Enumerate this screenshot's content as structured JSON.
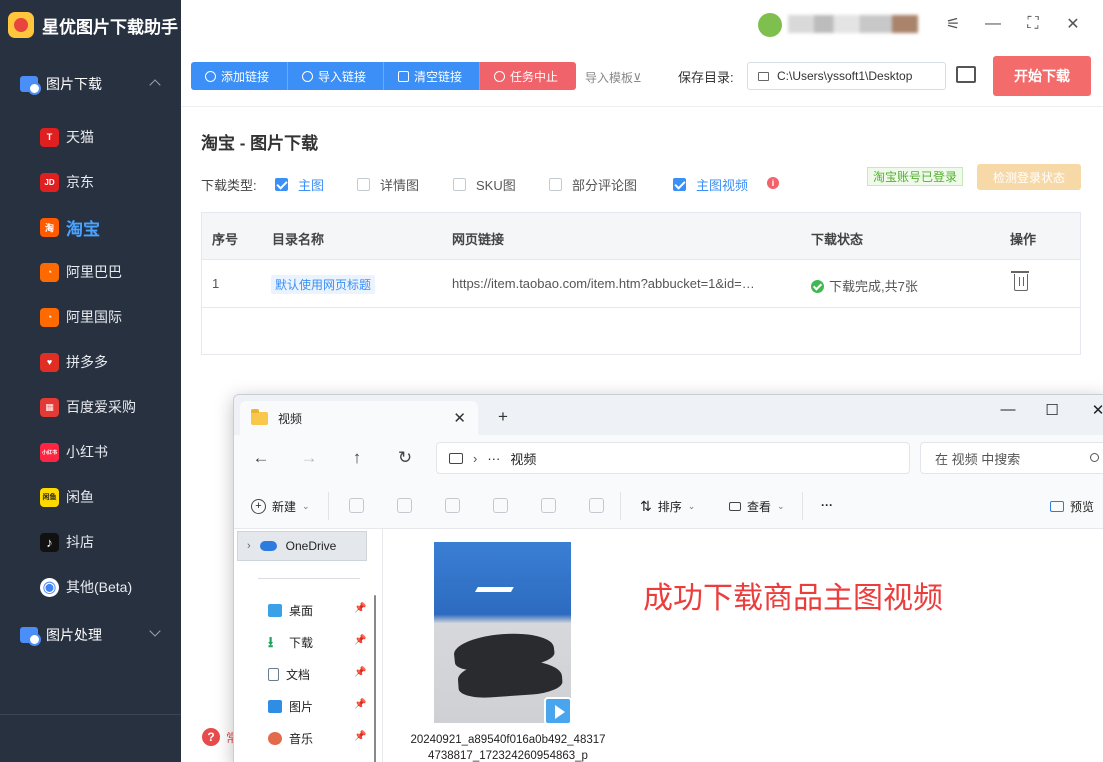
{
  "app": {
    "title": "星优图片下载助手"
  },
  "sidebar": {
    "groups": [
      {
        "label": "图片下载"
      },
      {
        "label": "图片处理"
      }
    ],
    "items": [
      {
        "label": "天猫",
        "icon": "T",
        "color": "#e02020"
      },
      {
        "label": "京东",
        "icon": "JD",
        "color": "#e02020"
      },
      {
        "label": "淘宝",
        "icon": "淘",
        "color": "#ff5a00"
      },
      {
        "label": "阿里巴巴",
        "icon": "◔",
        "color": "#ff6a00"
      },
      {
        "label": "阿里国际",
        "icon": "◔",
        "color": "#ff6a00"
      },
      {
        "label": "拼多多",
        "icon": "♥",
        "color": "#e02e24"
      },
      {
        "label": "百度爱采购",
        "icon": "▦",
        "color": "#e53935"
      },
      {
        "label": "小红书",
        "icon": "小红书",
        "color": "#ff2442"
      },
      {
        "label": "闲鱼",
        "icon": "闲鱼",
        "color": "#ffda00"
      },
      {
        "label": "抖店",
        "icon": "♪",
        "color": "#111111"
      },
      {
        "label": "其他(Beta)",
        "icon": "◉",
        "color": "#4285f4"
      }
    ],
    "footer_help": "?",
    "footer_text": "常"
  },
  "toolbar": {
    "add": "添加链接",
    "import": "导入链接",
    "clear": "清空链接",
    "stop": "任务中止",
    "template": "导入模板⊻",
    "save_label": "保存目录:",
    "save_path": "C:\\Users\\yssoft1\\Desktop",
    "start": "开始下载"
  },
  "section": {
    "title": "淘宝 - 图片下载",
    "type_label": "下载类型:",
    "options": [
      {
        "label": "主图",
        "checked": true
      },
      {
        "label": "详情图",
        "checked": false
      },
      {
        "label": "SKU图",
        "checked": false
      },
      {
        "label": "部分评论图",
        "checked": false
      },
      {
        "label": "主图视频",
        "checked": true
      }
    ],
    "info": "i",
    "login_status": "淘宝账号已登录",
    "check_login": "检测登录状态"
  },
  "table": {
    "headers": [
      "序号",
      "目录名称",
      "网页链接",
      "下载状态",
      "操作"
    ],
    "rows": [
      {
        "index": "1",
        "dir": "默认使用网页标题",
        "url": "https://item.taobao.com/item.htm?abbucket=1&id=…",
        "status": "下载完成,共7张"
      }
    ]
  },
  "explorer": {
    "tab_title": "视频",
    "new_tab": "+",
    "address_more": "···",
    "address": "视频",
    "search_placeholder": "在 视频 中搜索",
    "cmd_new": "新建",
    "cmd_sort": "排序",
    "cmd_view": "查看",
    "cmd_more": "···",
    "cmd_preview": "预览",
    "onedrive": "OneDrive",
    "quick_access": [
      "桌面",
      "下载",
      "文档",
      "图片",
      "音乐"
    ],
    "file_name": "20240921_a89540f016a0b492_483174738817_172324260954863_p",
    "caption": "成功下载商品主图视频"
  }
}
